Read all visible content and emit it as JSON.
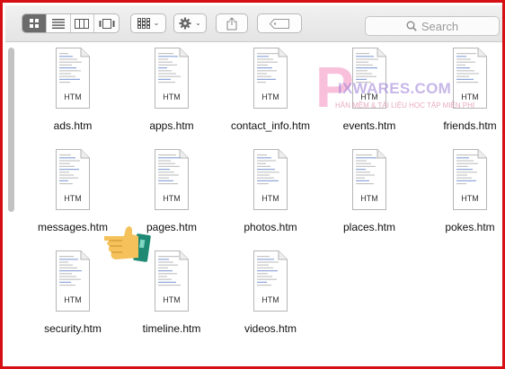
{
  "toolbar": {
    "view_buttons": [
      {
        "icon": "grid-view-icon",
        "active": true
      },
      {
        "icon": "list-view-icon",
        "active": false
      },
      {
        "icon": "column-view-icon",
        "active": false
      },
      {
        "icon": "cover-flow-icon",
        "active": false
      }
    ],
    "arrange_icon": "arrange-grid-icon",
    "action_icon": "gear-icon",
    "share_icon": "share-icon",
    "tag_icon": "tag-icon",
    "search_placeholder": "Search",
    "caret": "⌄"
  },
  "files": [
    {
      "name": "ads.htm",
      "type": "HTM"
    },
    {
      "name": "apps.htm",
      "type": "HTM"
    },
    {
      "name": "contact_info.htm",
      "type": "HTM"
    },
    {
      "name": "events.htm",
      "type": "HTM"
    },
    {
      "name": "friends.htm",
      "type": "HTM"
    },
    {
      "name": "messages.htm",
      "type": "HTM"
    },
    {
      "name": "pages.htm",
      "type": "HTM"
    },
    {
      "name": "photos.htm",
      "type": "HTM"
    },
    {
      "name": "places.htm",
      "type": "HTM"
    },
    {
      "name": "pokes.htm",
      "type": "HTM"
    },
    {
      "name": "security.htm",
      "type": "HTM"
    },
    {
      "name": "timeline.htm",
      "type": "HTM"
    },
    {
      "name": "videos.htm",
      "type": "HTM"
    }
  ],
  "watermark": {
    "letter": "P",
    "title": "IXWARES.COM",
    "tagline": "HẦN MỀM & TÀI LIỆU HỌC TẬP MIỄN PHÍ"
  },
  "colors": {
    "frame": "#d60f15",
    "active_segment": "#6b6b6b",
    "scroll_thumb": "#c2c2c2"
  }
}
